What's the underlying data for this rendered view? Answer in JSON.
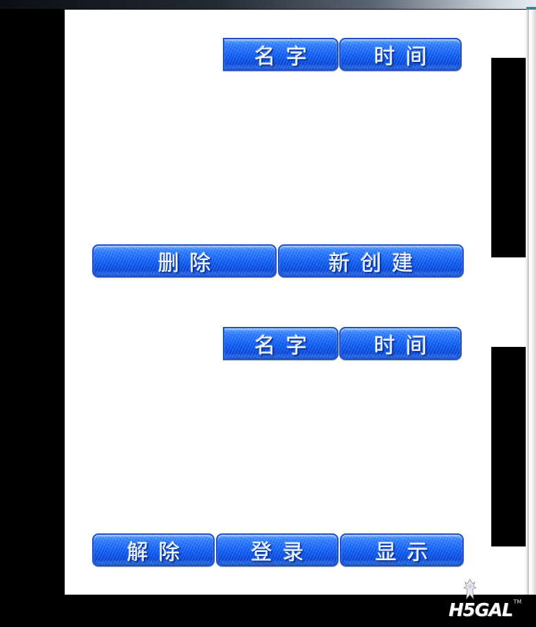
{
  "sections": [
    {
      "sort_buttons": {
        "name": "名字",
        "time": "时间"
      },
      "actions": {
        "delete": "删除",
        "create": "新创建"
      }
    },
    {
      "sort_buttons": {
        "name": "名字",
        "time": "时间"
      },
      "actions": {
        "unlock": "解除",
        "login": "登录",
        "display": "显示"
      }
    }
  ],
  "watermark": {
    "text": "H5GAL",
    "tm": "TM"
  },
  "colors": {
    "button_blue": "#0f5ef2",
    "panel": "#ffffff",
    "background": "#000000"
  }
}
